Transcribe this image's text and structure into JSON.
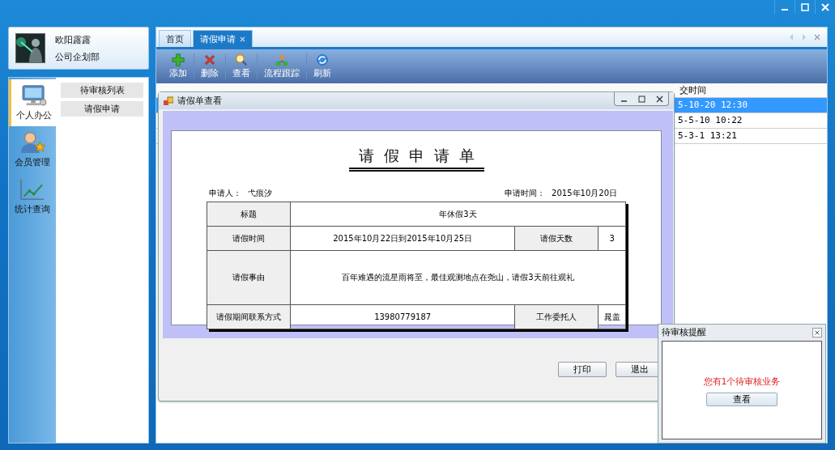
{
  "user": {
    "name": "欧阳露露",
    "department": "公司企划部"
  },
  "nav": [
    {
      "label": "个人办公",
      "kind": "monitor",
      "selected": true
    },
    {
      "label": "会员管理",
      "kind": "member",
      "selected": false
    },
    {
      "label": "统计查询",
      "kind": "chart",
      "selected": false
    }
  ],
  "submenu": [
    "待审核列表",
    "请假申请"
  ],
  "tabs": [
    {
      "label": "首页",
      "selected": false,
      "closable": false
    },
    {
      "label": "请假申请",
      "selected": true,
      "closable": true
    }
  ],
  "toolbar": [
    {
      "label": "添加",
      "kind": "add"
    },
    {
      "label": "删除",
      "kind": "delete"
    },
    {
      "label": "查看",
      "kind": "view"
    },
    {
      "label": "流程跟踪",
      "kind": "flow"
    },
    {
      "label": "刷新",
      "kind": "refresh"
    }
  ],
  "grid": {
    "column_4": "交时间",
    "rows": [
      {
        "submitted": "5-10-20 12:30",
        "selected": true
      },
      {
        "submitted": "5-5-10 10:22",
        "selected": false
      },
      {
        "submitted": "5-3-1 13:21",
        "selected": false
      }
    ]
  },
  "dialog": {
    "title": "请假单查看",
    "heading": "请假申请单",
    "applicant_label": "申请人：",
    "applicant": "弋痕汐",
    "date_label": "申请时间：",
    "date": "2015年10月20日",
    "rows": [
      {
        "cells": [
          {
            "text": "标题",
            "kind": "label"
          },
          {
            "text": "年休假3天",
            "kind": "wide",
            "colspan": 3
          }
        ]
      },
      {
        "cells": [
          {
            "text": "请假时间",
            "kind": "label"
          },
          {
            "text": "2015年10月22日到2015年10月25日",
            "kind": "value"
          },
          {
            "text": "请假天数",
            "kind": "label"
          },
          {
            "text": "3",
            "kind": "value"
          }
        ]
      },
      {
        "cells": [
          {
            "text": "请假事由",
            "kind": "label"
          },
          {
            "text": "百年难遇的流星雨将至，最佳观测地点在尧山，请假3天前往观礼",
            "kind": "wide",
            "colspan": 3
          }
        ]
      },
      {
        "cells": [
          {
            "text": "请假期间联系方式",
            "kind": "label"
          },
          {
            "text": "13980779187",
            "kind": "value"
          },
          {
            "text": "工作委托人",
            "kind": "label"
          },
          {
            "text": "晁盖",
            "kind": "value"
          }
        ]
      }
    ],
    "buttons": [
      "打印",
      "退出"
    ]
  },
  "reminder": {
    "title": "待审核提醒",
    "message": "您有1个待审核业务",
    "button": "查看"
  }
}
